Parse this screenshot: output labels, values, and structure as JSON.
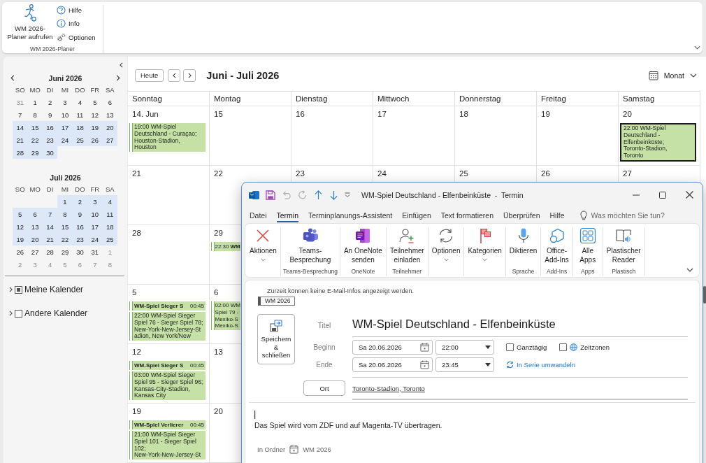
{
  "ribbon": {
    "big_button": "WM 2026-\nPlaner aufrufen",
    "small_buttons": [
      {
        "kind": "help",
        "label": "Hilfe"
      },
      {
        "kind": "info",
        "label": "Info"
      },
      {
        "kind": "options",
        "label": "Optionen"
      }
    ],
    "group_label": "WM 2026-Planer"
  },
  "sidebar": {
    "mini_calendars": [
      {
        "title": "Juni 2026",
        "nav_arrows": true,
        "weekdays": [
          "SO",
          "MO",
          "DI",
          "MI",
          "DO",
          "FR",
          "SA"
        ],
        "weeks": [
          [
            {
              "kind": "day",
              "day": "31",
              "other_month": true,
              "selected": false
            },
            {
              "kind": "day",
              "day": "1",
              "other_month": false,
              "selected": false
            },
            {
              "kind": "day",
              "day": "2",
              "other_month": false,
              "selected": false
            },
            {
              "kind": "day",
              "day": "3",
              "other_month": false,
              "selected": false
            },
            {
              "kind": "day",
              "day": "4",
              "other_month": false,
              "selected": false
            },
            {
              "kind": "day",
              "day": "5",
              "other_month": false,
              "selected": false
            },
            {
              "kind": "day",
              "day": "6",
              "other_month": false,
              "selected": false
            }
          ],
          [
            {
              "kind": "day",
              "day": "7",
              "other_month": false,
              "selected": false
            },
            {
              "kind": "day",
              "day": "8",
              "other_month": false,
              "selected": false
            },
            {
              "kind": "day",
              "day": "9",
              "other_month": false,
              "selected": false
            },
            {
              "kind": "day",
              "day": "10",
              "other_month": false,
              "selected": false
            },
            {
              "kind": "day",
              "day": "11",
              "other_month": false,
              "selected": false
            },
            {
              "kind": "day",
              "day": "12",
              "other_month": false,
              "selected": false
            },
            {
              "kind": "day",
              "day": "13",
              "other_month": false,
              "selected": false
            }
          ],
          [
            {
              "kind": "day",
              "day": "14",
              "other_month": false,
              "selected": true
            },
            {
              "kind": "day",
              "day": "15",
              "other_month": false,
              "selected": true
            },
            {
              "kind": "day",
              "day": "16",
              "other_month": false,
              "selected": true
            },
            {
              "kind": "day",
              "day": "17",
              "other_month": false,
              "selected": true
            },
            {
              "kind": "day",
              "day": "18",
              "other_month": false,
              "selected": true
            },
            {
              "kind": "day",
              "day": "19",
              "other_month": false,
              "selected": true
            },
            {
              "kind": "day",
              "day": "20",
              "other_month": false,
              "selected": true
            }
          ],
          [
            {
              "kind": "day",
              "day": "21",
              "other_month": false,
              "selected": true
            },
            {
              "kind": "day",
              "day": "22",
              "other_month": false,
              "selected": true
            },
            {
              "kind": "day",
              "day": "23",
              "other_month": false,
              "selected": true
            },
            {
              "kind": "day",
              "day": "24",
              "other_month": false,
              "selected": true
            },
            {
              "kind": "day",
              "day": "25",
              "other_month": false,
              "selected": true
            },
            {
              "kind": "day",
              "day": "26",
              "other_month": false,
              "selected": true
            },
            {
              "kind": "day",
              "day": "27",
              "other_month": false,
              "selected": true
            }
          ],
          [
            {
              "kind": "day",
              "day": "28",
              "other_month": false,
              "selected": true
            },
            {
              "kind": "day",
              "day": "29",
              "other_month": false,
              "selected": true
            },
            {
              "kind": "day",
              "day": "30",
              "other_month": false,
              "selected": true
            },
            {
              "kind": "blank"
            },
            {
              "kind": "blank"
            },
            {
              "kind": "blank"
            },
            {
              "kind": "blank"
            }
          ]
        ]
      },
      {
        "title": "Juli 2026",
        "weekdays": [
          "SO",
          "MO",
          "DI",
          "MI",
          "DO",
          "FR",
          "SA"
        ],
        "weeks": [
          [
            {
              "kind": "blank"
            },
            {
              "kind": "blank"
            },
            {
              "kind": "blank"
            },
            {
              "kind": "day",
              "day": "1",
              "other_month": false,
              "selected": true
            },
            {
              "kind": "day",
              "day": "2",
              "other_month": false,
              "selected": true
            },
            {
              "kind": "day",
              "day": "3",
              "other_month": false,
              "selected": true
            },
            {
              "kind": "day",
              "day": "4",
              "other_month": false,
              "selected": true
            }
          ],
          [
            {
              "kind": "day",
              "day": "5",
              "other_month": false,
              "selected": true
            },
            {
              "kind": "day",
              "day": "6",
              "other_month": false,
              "selected": true
            },
            {
              "kind": "day",
              "day": "7",
              "other_month": false,
              "selected": true
            },
            {
              "kind": "day",
              "day": "8",
              "other_month": false,
              "selected": true
            },
            {
              "kind": "day",
              "day": "9",
              "other_month": false,
              "selected": true
            },
            {
              "kind": "day",
              "day": "10",
              "other_month": false,
              "selected": true
            },
            {
              "kind": "day",
              "day": "11",
              "other_month": false,
              "selected": true
            }
          ],
          [
            {
              "kind": "day",
              "day": "12",
              "other_month": false,
              "selected": true
            },
            {
              "kind": "day",
              "day": "13",
              "other_month": false,
              "selected": true
            },
            {
              "kind": "day",
              "day": "14",
              "other_month": false,
              "selected": true
            },
            {
              "kind": "day",
              "day": "15",
              "other_month": false,
              "selected": true
            },
            {
              "kind": "day",
              "day": "16",
              "other_month": false,
              "selected": true
            },
            {
              "kind": "day",
              "day": "17",
              "other_month": false,
              "selected": true
            },
            {
              "kind": "day",
              "day": "18",
              "other_month": false,
              "selected": true
            }
          ],
          [
            {
              "kind": "day",
              "day": "19",
              "other_month": false,
              "selected": true
            },
            {
              "kind": "day",
              "day": "20",
              "other_month": false,
              "selected": true
            },
            {
              "kind": "day",
              "day": "21",
              "other_month": false,
              "selected": true
            },
            {
              "kind": "day",
              "day": "22",
              "other_month": false,
              "selected": true
            },
            {
              "kind": "day",
              "day": "23",
              "other_month": false,
              "selected": true
            },
            {
              "kind": "day",
              "day": "24",
              "other_month": false,
              "selected": true
            },
            {
              "kind": "day",
              "day": "25",
              "other_month": false,
              "selected": true
            }
          ],
          [
            {
              "kind": "day",
              "day": "26",
              "other_month": false,
              "selected": false
            },
            {
              "kind": "day",
              "day": "27",
              "other_month": false,
              "selected": false
            },
            {
              "kind": "day",
              "day": "28",
              "other_month": false,
              "selected": false
            },
            {
              "kind": "day",
              "day": "29",
              "other_month": false,
              "selected": false
            },
            {
              "kind": "day",
              "day": "30",
              "other_month": false,
              "selected": false
            },
            {
              "kind": "day",
              "day": "31",
              "other_month": false,
              "selected": false
            },
            {
              "kind": "day",
              "day": "1",
              "other_month": true,
              "selected": false
            }
          ],
          [
            {
              "kind": "day",
              "day": "2",
              "other_month": true,
              "selected": false
            },
            {
              "kind": "day",
              "day": "3",
              "other_month": true,
              "selected": false
            },
            {
              "kind": "day",
              "day": "4",
              "other_month": true,
              "selected": false
            },
            {
              "kind": "day",
              "day": "5",
              "other_month": true,
              "selected": false
            },
            {
              "kind": "day",
              "day": "6",
              "other_month": true,
              "selected": false
            },
            {
              "kind": "day",
              "day": "7",
              "other_month": true,
              "selected": false
            },
            {
              "kind": "day",
              "day": "8",
              "other_month": true,
              "selected": false
            }
          ]
        ]
      }
    ],
    "calendar_groups": [
      {
        "label": "Meine Kalender",
        "checked": true,
        "expanded": false
      },
      {
        "label": "Andere Kalender",
        "checked": false,
        "expanded": false
      }
    ]
  },
  "calendar": {
    "today_button": "Heute",
    "title": "Juni - Juli 2026",
    "view": "Monat",
    "weekdays": [
      "Sonntag",
      "Montag",
      "Dienstag",
      "Mittwoch",
      "Donnerstag",
      "Freitag",
      "Samstag"
    ],
    "weeks": [
      {
        "days": [
          {
            "date": "14. Jun",
            "events": [
              {
                "kind": "timed",
                "lines": [
                  "19:00 WM-Spiel",
                  "Deutschland - Curaçao;",
                  "Houston-Stadion,",
                  "Houston"
                ],
                "selected": false
              }
            ]
          },
          {
            "date": "15"
          },
          {
            "date": "16"
          },
          {
            "date": "17"
          },
          {
            "date": "18"
          },
          {
            "date": "19"
          },
          {
            "date": "20",
            "events": [
              {
                "kind": "timed",
                "lines": [
                  "22:00 WM-Spiel",
                  "Deutschland -",
                  "Elfenbeinküste;",
                  "Toronto-Stadion,",
                  "Toronto"
                ],
                "selected": true
              }
            ]
          }
        ]
      },
      {
        "days": [
          {
            "date": "21"
          },
          {
            "date": "22"
          },
          {
            "date": "23"
          },
          {
            "date": "24"
          },
          {
            "date": "25"
          },
          {
            "date": "26"
          },
          {
            "date": "27"
          }
        ]
      },
      {
        "days": [
          {
            "date": "28"
          },
          {
            "date": "29",
            "events": [
              {
                "kind": "short",
                "time": "22:30",
                "title": "WM",
                "selected": false
              }
            ]
          }
        ]
      },
      {
        "days": [
          {
            "date": "5",
            "events": [
              {
                "kind": "bar",
                "title": "WM-Spiel Sieger S",
                "time": "00:45",
                "selected": false
              },
              {
                "kind": "timed",
                "lines": [
                  "22:00 WM-Spiel Sieger",
                  "Spiel 76 - Sieger Spiel 78;",
                  "New-York-New-Jersey-St",
                  "adion, New York/New"
                ],
                "selected": false
              }
            ]
          },
          {
            "date": "6",
            "events": [
              {
                "kind": "timed",
                "lines": [
                  "02:00 WM",
                  "Spiel 79 -",
                  "Mexiko-S",
                  "Mexiko-S"
                ],
                "selected": false
              }
            ]
          }
        ]
      },
      {
        "days": [
          {
            "date": "12",
            "events": [
              {
                "kind": "bar",
                "title": "WM-Spiel Sieger S",
                "time": "00:45",
                "selected": false
              },
              {
                "kind": "timed",
                "lines": [
                  "03:00 WM-Spiel Sieger",
                  "Spiel 95 - Sieger Spiel 96;",
                  "Kansas-City-Stadion,",
                  "Kansas City"
                ],
                "selected": false
              }
            ]
          },
          {
            "date": "13"
          }
        ]
      },
      {
        "days": [
          {
            "date": "19",
            "events": [
              {
                "kind": "bar",
                "title": "WM-Spiel Verlierer",
                "time": "00:45",
                "selected": false
              },
              {
                "kind": "timed",
                "lines": [
                  "21:00 WM-Spiel Sieger",
                  "Spiel 101 - Sieger Spiel",
                  "102;",
                  "New-York-New-Jersey-St"
                ],
                "selected": false
              }
            ]
          },
          {
            "date": "20"
          }
        ]
      }
    ]
  },
  "appointment_window": {
    "title": "WM-Spiel Deutschland - Elfenbeinküste  -  Termin",
    "toolbar": [
      {
        "kind": "app",
        "disabled": false
      },
      {
        "kind": "save",
        "disabled": false
      },
      {
        "kind": "undo",
        "disabled": true
      },
      {
        "kind": "redo",
        "disabled": true
      },
      {
        "kind": "up",
        "disabled": false
      },
      {
        "kind": "down",
        "disabled": false
      },
      {
        "kind": "customize",
        "disabled": false
      }
    ],
    "menu_tabs": [
      {
        "label": "Datei",
        "selected": false
      },
      {
        "label": "Termin",
        "selected": true
      },
      {
        "label": "Terminplanungs-Assistent",
        "selected": false
      },
      {
        "label": "Einfügen",
        "selected": false
      },
      {
        "label": "Text formatieren",
        "selected": false
      },
      {
        "label": "Überprüfen",
        "selected": false
      },
      {
        "label": "Hilfe",
        "selected": false
      }
    ],
    "tell_me": {
      "placeholder": "Was möchten Sie tun?"
    },
    "ribbon_groups": [
      {
        "buttons": [
          {
            "kind": "actions",
            "label": "Aktionen",
            "dropdown": true
          }
        ]
      },
      {
        "label": "Teams-Besprechung",
        "buttons": [
          {
            "kind": "teams",
            "label": "Teams-\nBesprechung",
            "dropdown": false
          }
        ]
      },
      {
        "label": "OneNote",
        "buttons": [
          {
            "kind": "onenote",
            "label": "An OneNote\nsenden",
            "dropdown": false
          }
        ]
      },
      {
        "label": "Teilnehmer",
        "buttons": [
          {
            "kind": "invite",
            "label": "Teilnehmer\neinladen",
            "dropdown": false
          }
        ]
      },
      {
        "buttons": [
          {
            "kind": "options",
            "label": "Optionen",
            "dropdown": true
          }
        ]
      },
      {
        "buttons": [
          {
            "kind": "categories",
            "label": "Kategorien",
            "dropdown": true
          }
        ]
      },
      {
        "label": "Sprache",
        "buttons": [
          {
            "kind": "dictate",
            "label": "Diktieren",
            "dropdown": false
          }
        ]
      },
      {
        "label": "Add-Ins",
        "buttons": [
          {
            "kind": "addins",
            "label": "Office-\nAdd-Ins",
            "dropdown": false
          }
        ]
      },
      {
        "label": "Apps",
        "buttons": [
          {
            "kind": "apps",
            "label": "Alle\nApps",
            "dropdown": false
          }
        ]
      },
      {
        "label": "Plastisch",
        "buttons": [
          {
            "kind": "reader",
            "label": "Plastischer\nReader",
            "dropdown": false
          }
        ]
      }
    ],
    "mail_tips": "Zurzeit können keine E-Mail-Infos angezeigt werden.",
    "category": "WM 2026",
    "save_close_button": "Speichern\n&\nschließen",
    "title_field": {
      "label": "Titel",
      "value": "WM-Spiel Deutschland - Elfenbeinküste"
    },
    "start": {
      "label": "Beginn",
      "date": "Sa 20.06.2026",
      "time": "22:00"
    },
    "end": {
      "label": "Ende",
      "date": "Sa 20.06.2026",
      "time": "23:45"
    },
    "all_day": {
      "label": "Ganztägig",
      "checked": false
    },
    "time_zones": {
      "label": "Zeitzonen",
      "checked": false
    },
    "recurrence_link": "In Serie umwandeln",
    "location": {
      "button": "Ort",
      "value": "Toronto-Stadion, Toronto"
    },
    "body": "Das Spiel wird vom ZDF und auf Magenta-TV übertragen.",
    "folder": {
      "label": "In Ordner",
      "value": "WM 2026"
    }
  }
}
